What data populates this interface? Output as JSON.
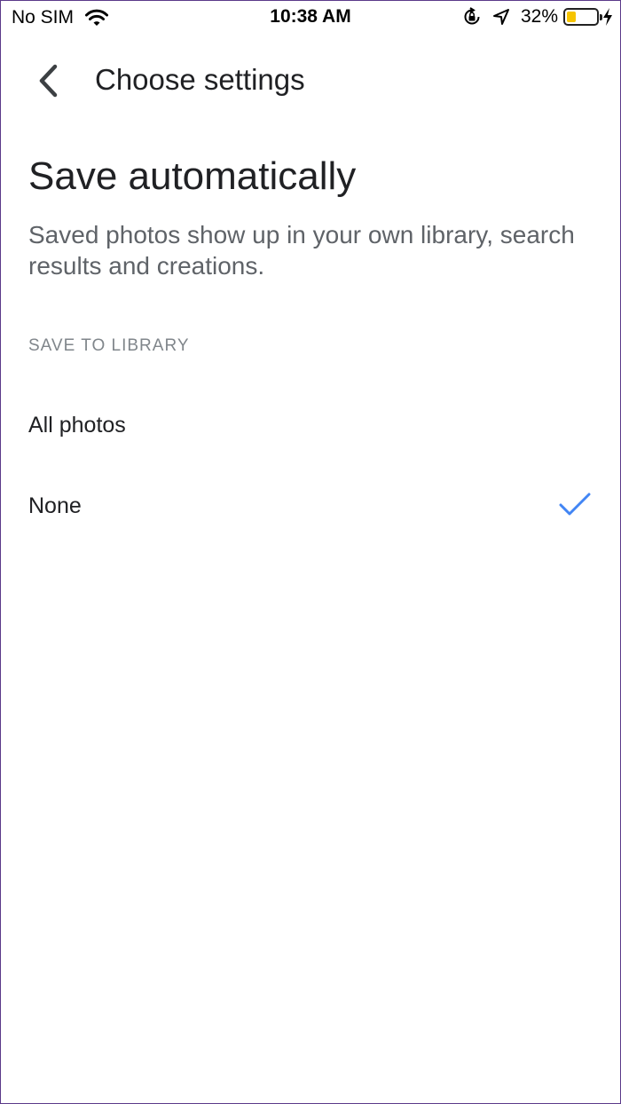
{
  "status_bar": {
    "carrier": "No SIM",
    "time": "10:38 AM",
    "battery_percent": "32%",
    "battery_level": 0.32,
    "icons": [
      "wifi-icon",
      "orientation-lock-icon",
      "location-arrow-icon",
      "battery-icon",
      "charging-bolt-icon"
    ]
  },
  "header": {
    "back_icon": "chevron-left-icon",
    "title": "Choose settings"
  },
  "main": {
    "title": "Save automatically",
    "description": "Saved photos show up in your own library, search results and creations.",
    "section_label": "SAVE TO LIBRARY",
    "options": [
      {
        "label": "All photos",
        "selected": false
      },
      {
        "label": "None",
        "selected": true
      }
    ],
    "check_icon": "checkmark-icon",
    "accent_color": "#4285f4"
  }
}
